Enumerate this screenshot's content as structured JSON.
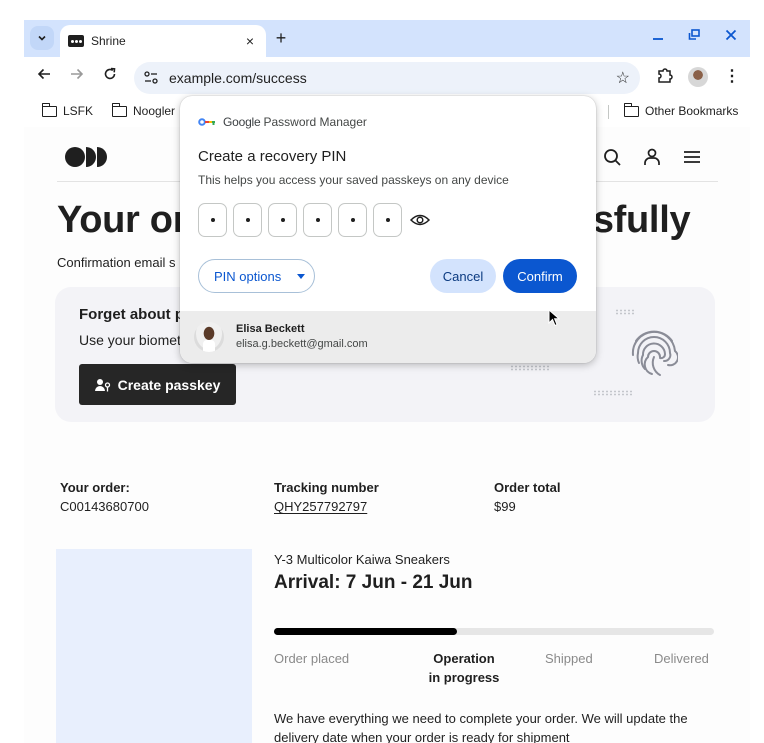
{
  "browser": {
    "tab": {
      "title": "Shrine",
      "close_icon": "×"
    },
    "new_tab_icon": "+",
    "window_controls": {
      "minimize": "–",
      "restore": "⧉",
      "close": "✕"
    },
    "toolbar": {
      "back_icon": "←",
      "forward_icon": "→",
      "reload_icon": "↻",
      "url": "example.com/success",
      "bookmark_star_icon": "☆",
      "menu_icon": "⋮"
    },
    "bookmarks": [
      {
        "label": "LSFK"
      },
      {
        "label": "Noogler"
      },
      {
        "label": "Other Bookmarks"
      }
    ]
  },
  "page": {
    "headline_left": "Your or",
    "headline_right": "ssfully",
    "confirmation_email": "Confirmation email s",
    "passkey_card": {
      "title": "Forget about p",
      "subtitle": "Use your biomet",
      "button_label": "Create passkey"
    },
    "order": {
      "order_label": "Your order:",
      "order_value": "C00143680700",
      "tracking_label": "Tracking number",
      "tracking_value": "QHY257792797",
      "total_label": "Order total",
      "total_value": "$99"
    },
    "product": {
      "name": "Y-3 Multicolor Kaiwa Sneakers",
      "arrival": "Arrival: 7 Jun - 21 Jun",
      "progress_fraction": 0.415,
      "steps": [
        {
          "label": "Order placed",
          "active": false
        },
        {
          "label": "Operation in progress",
          "line1": "Operation",
          "line2": "in progress",
          "active": true
        },
        {
          "label": "Shipped",
          "active": false
        },
        {
          "label": "Delivered",
          "active": false
        }
      ],
      "message": "We have everything we need to complete your order. We will update the delivery date when your order is ready for shipment"
    }
  },
  "password_manager": {
    "brand_google": "Google",
    "brand_product": "Password Manager",
    "title": "Create a recovery PIN",
    "subtitle": "This helps you access your saved passkeys on any device",
    "pin_length": 6,
    "pin_options_label": "PIN options",
    "cancel_label": "Cancel",
    "confirm_label": "Confirm",
    "account": {
      "name": "Elisa Beckett",
      "email": "elisa.g.beckett@gmail.com"
    }
  },
  "colors": {
    "accent": "#0b57d0",
    "tabstrip": "#d3e3fd",
    "cancel_bg": "#d3e3fd",
    "dark_button": "#262626",
    "product_placeholder": "#e8effd"
  }
}
